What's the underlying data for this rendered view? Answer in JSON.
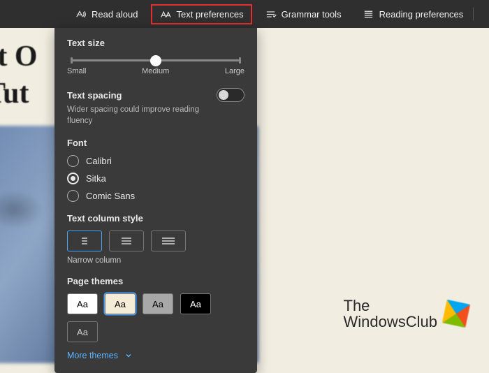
{
  "toolbar": {
    "items": [
      {
        "label": "Read aloud"
      },
      {
        "label": "Text preferences"
      },
      {
        "label": "Grammar tools"
      },
      {
        "label": "Reading preferences"
      }
    ]
  },
  "background": {
    "line1": "st O",
    "line2": "Tut"
  },
  "watermark": {
    "line1": "The",
    "line2": "WindowsClub"
  },
  "panel": {
    "text_size": {
      "title": "Text size",
      "labels": {
        "small": "Small",
        "medium": "Medium",
        "large": "Large"
      },
      "value_pct": 50
    },
    "text_spacing": {
      "title": "Text spacing",
      "desc": "Wider spacing could improve reading fluency",
      "enabled": false
    },
    "font": {
      "title": "Font",
      "options": [
        {
          "label": "Calibri",
          "checked": false
        },
        {
          "label": "Sitka",
          "checked": true
        },
        {
          "label": "Comic Sans",
          "checked": false
        }
      ]
    },
    "column_style": {
      "title": "Text column style",
      "caption": "Narrow column",
      "selected_index": 0
    },
    "page_themes": {
      "title": "Page themes",
      "sample": "Aa",
      "themes": [
        {
          "bg": "#ffffff",
          "fg": "#000000"
        },
        {
          "bg": "#f5ecd7",
          "fg": "#000000",
          "selected": true
        },
        {
          "bg": "#a8a8a8",
          "fg": "#000000"
        },
        {
          "bg": "#000000",
          "fg": "#ffffff"
        },
        {
          "bg": "#3a3a3a",
          "fg": "#cfcfcf"
        }
      ],
      "more_label": "More themes"
    }
  }
}
